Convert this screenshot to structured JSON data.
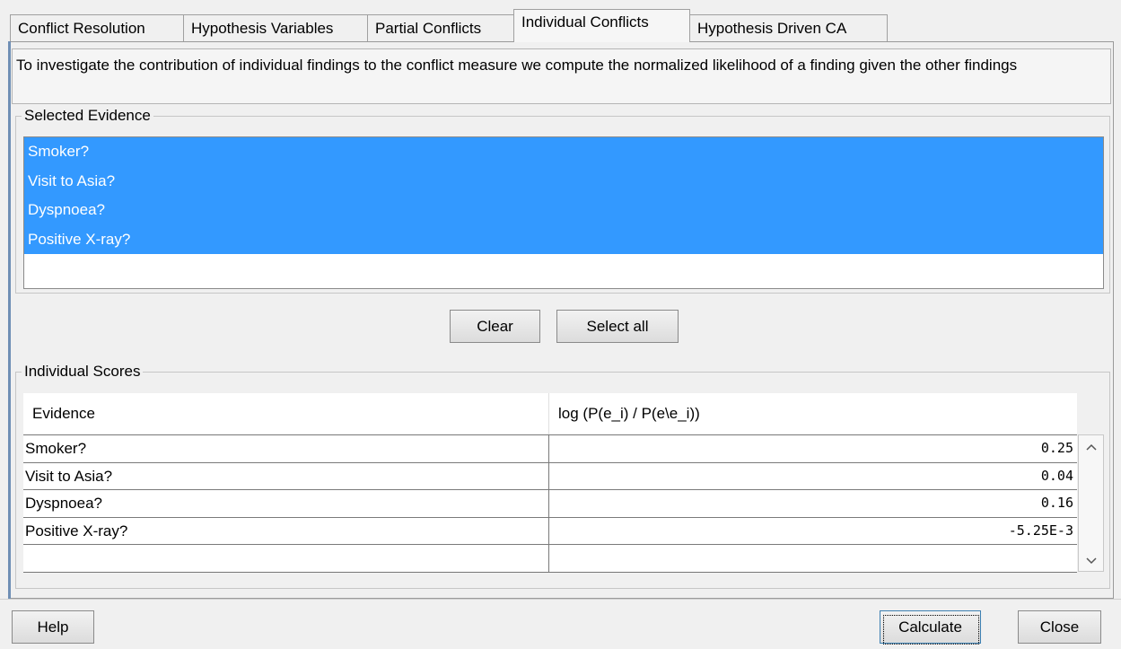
{
  "tabs": [
    {
      "label": "Conflict Resolution",
      "active": false
    },
    {
      "label": "Hypothesis Variables",
      "active": false
    },
    {
      "label": "Partial Conflicts",
      "active": false
    },
    {
      "label": "Individual Conflicts",
      "active": true
    },
    {
      "label": "Hypothesis Driven CA",
      "active": false
    }
  ],
  "description": "To investigate the contribution of individual findings to the conflict measure we compute the normalized likelihood of a finding given the other findings",
  "selected_evidence": {
    "title": "Selected Evidence",
    "items": [
      "Smoker?",
      "Visit to Asia?",
      "Dyspnoea?",
      "Positive X-ray?"
    ],
    "clear_label": "Clear",
    "select_all_label": "Select all"
  },
  "individual_scores": {
    "title": "Individual Scores",
    "columns": [
      "Evidence",
      "log (P(e_i) / P(e\\e_i))"
    ],
    "rows": [
      [
        "Smoker?",
        "0.25"
      ],
      [
        "Visit to Asia?",
        "0.04"
      ],
      [
        "Dyspnoea?",
        "0.16"
      ],
      [
        "Positive X-ray?",
        "-5.25E-3"
      ],
      [
        "",
        ""
      ]
    ]
  },
  "footer": {
    "help_label": "Help",
    "calculate_label": "Calculate",
    "close_label": "Close"
  },
  "colors": {
    "selection": "#3399ff",
    "panel": "#f0f0f0"
  },
  "icons": {
    "scroll_up": "chevron-up-icon",
    "scroll_down": "chevron-down-icon"
  }
}
